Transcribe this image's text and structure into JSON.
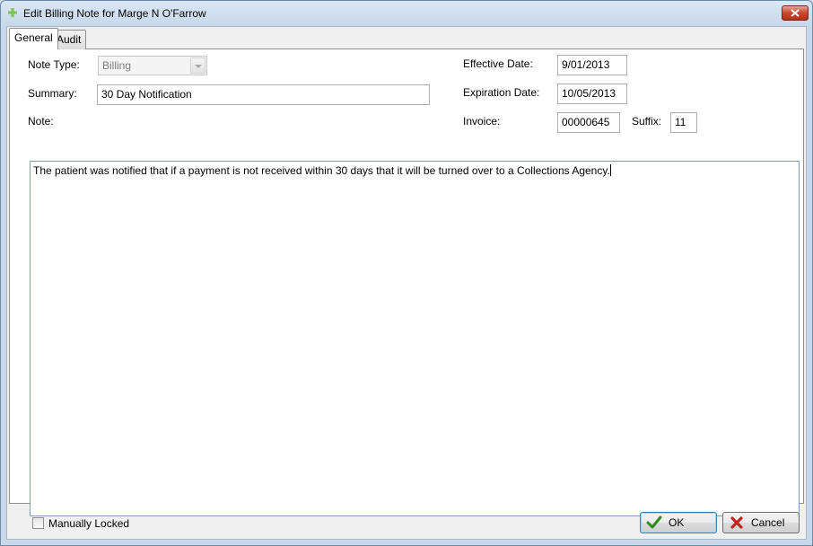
{
  "window": {
    "title": "Edit Billing Note for Marge N O'Farrow"
  },
  "tabs": [
    {
      "label": "General"
    },
    {
      "label": "Audit"
    }
  ],
  "form": {
    "note_type": {
      "label": "Note Type:",
      "value": "Billing"
    },
    "summary": {
      "label": "Summary:",
      "value": "30 Day Notification"
    },
    "note": {
      "label": "Note:",
      "value": "The patient was notified that if a payment is not received within 30 days that it will be turned over to a Collections Agency."
    },
    "effective_date": {
      "label": "Effective Date:",
      "value": "9/01/2013"
    },
    "expiration_date": {
      "label": "Expiration Date:",
      "value": "10/05/2013"
    },
    "invoice": {
      "label": "Invoice:",
      "value": "00000645"
    },
    "suffix": {
      "label": "Suffix:",
      "value": "11"
    }
  },
  "footer": {
    "manually_locked": {
      "label": "Manually Locked",
      "checked": false
    },
    "ok_label": "OK",
    "cancel_label": "Cancel"
  },
  "colors": {
    "ok_check": "#2e8b1f",
    "cancel_x": "#c0271b",
    "close_button": "#c8462f"
  }
}
